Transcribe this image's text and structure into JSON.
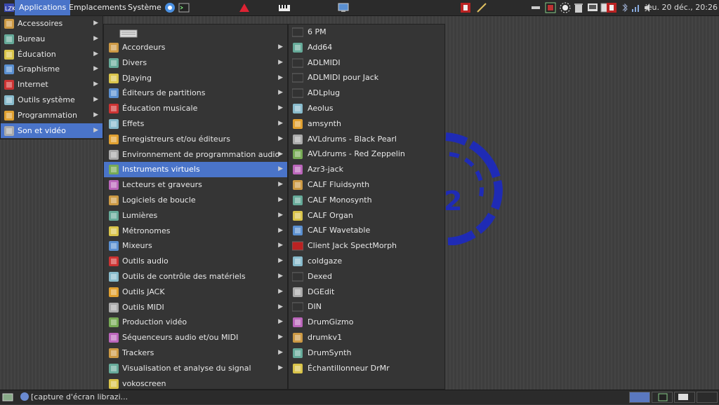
{
  "top_panel": {
    "applications": "Applications",
    "places": "Emplacements",
    "system": "Système",
    "clock": "jeu. 20 déc., 20:26"
  },
  "main_menu": [
    {
      "label": "Accessoires",
      "icon": "accessories-icon"
    },
    {
      "label": "Bureau",
      "icon": "office-icon"
    },
    {
      "label": "Éducation",
      "icon": "education-icon"
    },
    {
      "label": "Graphisme",
      "icon": "graphics-icon"
    },
    {
      "label": "Internet",
      "icon": "internet-icon"
    },
    {
      "label": "Outils système",
      "icon": "system-tools-icon"
    },
    {
      "label": "Programmation",
      "icon": "programming-icon"
    },
    {
      "label": "Son et vidéo",
      "icon": "sound-video-icon"
    }
  ],
  "sound_menu": [
    {
      "label": "Accordeurs"
    },
    {
      "label": "Divers"
    },
    {
      "label": "DJaying"
    },
    {
      "label": "Éditeurs de partitions"
    },
    {
      "label": "Éducation musicale"
    },
    {
      "label": "Effets"
    },
    {
      "label": "Enregistreurs et/ou éditeurs"
    },
    {
      "label": "Environnement de programmation audio"
    },
    {
      "label": "Instruments virtuels"
    },
    {
      "label": "Lecteurs et graveurs"
    },
    {
      "label": "Logiciels de boucle"
    },
    {
      "label": "Lumières"
    },
    {
      "label": "Métronomes"
    },
    {
      "label": "Mixeurs"
    },
    {
      "label": "Outils audio"
    },
    {
      "label": "Outils de contrôle des matériels"
    },
    {
      "label": "Outils JACK"
    },
    {
      "label": "Outils MIDI"
    },
    {
      "label": "Production vidéo"
    },
    {
      "label": "Séquenceurs audio et/ou MIDI"
    },
    {
      "label": "Trackers"
    },
    {
      "label": "Visualisation et analyse du signal"
    },
    {
      "label": "vokoscreen"
    }
  ],
  "instruments_menu": [
    {
      "label": "6 PM",
      "badge": "6PM"
    },
    {
      "label": "Add64",
      "badge": ""
    },
    {
      "label": "ADLMIDI",
      "badge": "ADL"
    },
    {
      "label": "ADLMIDI pour Jack",
      "badge": "ADL"
    },
    {
      "label": "ADLplug",
      "badge": "ADL"
    },
    {
      "label": "Aeolus",
      "badge": ""
    },
    {
      "label": "amsynth",
      "badge": ""
    },
    {
      "label": "AVLdrums - Black Pearl",
      "badge": ""
    },
    {
      "label": "AVLdrums - Red Zeppelin",
      "badge": ""
    },
    {
      "label": "Azr3-jack",
      "badge": ""
    },
    {
      "label": "CALF Fluidsynth",
      "badge": ""
    },
    {
      "label": "CALF Monosynth",
      "badge": ""
    },
    {
      "label": "CALF Organ",
      "badge": ""
    },
    {
      "label": "CALF Wavetable",
      "badge": ""
    },
    {
      "label": "Client Jack SpectMorph",
      "badge": "SM"
    },
    {
      "label": "coldgaze",
      "badge": ""
    },
    {
      "label": "Dexed",
      "badge": "DEXED"
    },
    {
      "label": "DGEdit",
      "badge": ""
    },
    {
      "label": "DIN",
      "badge": "din"
    },
    {
      "label": "DrumGizmo",
      "badge": ""
    },
    {
      "label": "drumkv1",
      "badge": ""
    },
    {
      "label": "DrumSynth",
      "badge": ""
    },
    {
      "label": "Échantillonneur DrMr",
      "badge": ""
    }
  ],
  "bottom_panel": {
    "task": "[capture d'écran librazi..."
  }
}
